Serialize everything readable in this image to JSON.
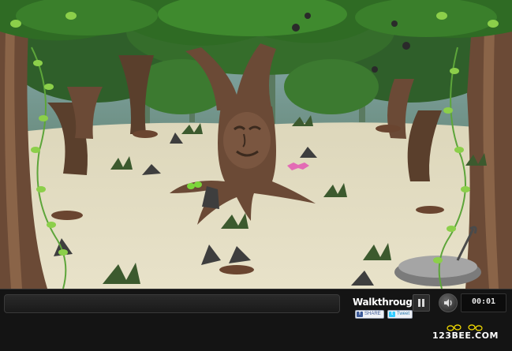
{
  "scene": {
    "name": "forest clearing with talking tree",
    "colors": {
      "sky": "#7aa0a8",
      "ground": "#e5dfc6",
      "canopy": "#2f6b24",
      "leaf": "#76b83a",
      "trunk": "#6b4a36",
      "rock": "#3e3e3e"
    }
  },
  "hud": {
    "walkthrough_label": "Walkthrough",
    "share_label": "SHARE",
    "tweet_label": "Tweet",
    "timer": "00:01",
    "logo_text": "123BEE.COM",
    "icons": {
      "pause": "pause-icon",
      "sound": "speaker-icon",
      "share": "facebook-icon",
      "tweet": "twitter-icon"
    },
    "colors": {
      "bar": "#141414",
      "text": "#ffffff",
      "wing": "#ffe600"
    }
  }
}
